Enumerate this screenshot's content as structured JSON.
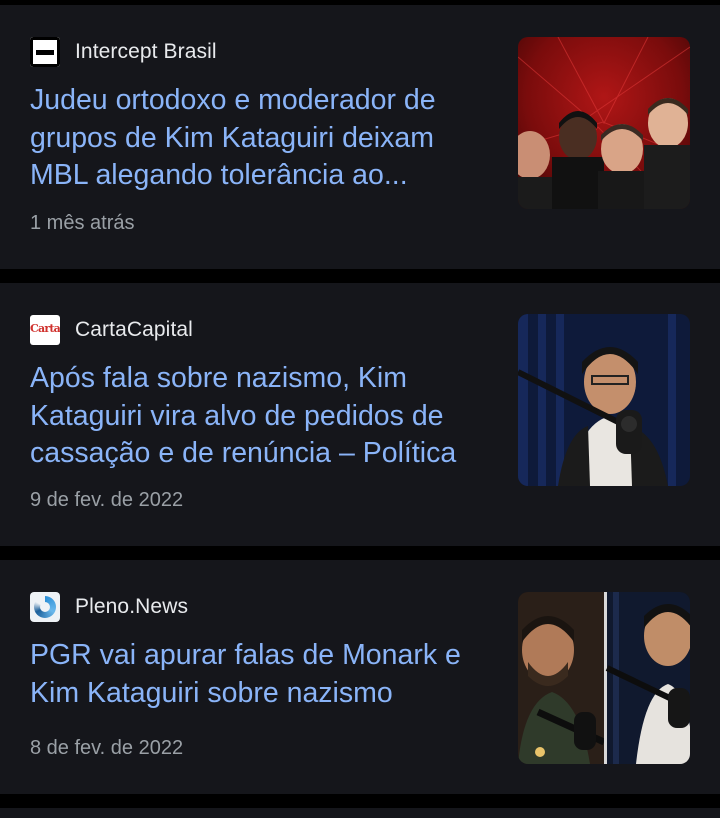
{
  "feed": {
    "articles": [
      {
        "source": "Intercept Brasil",
        "favicon_icon": "intercept-brasil-logo-icon",
        "headline": "Judeu ortodoxo e moderador de grupos de Kim Kataguiri deixam MBL alegando tolerância ao...",
        "timestamp": "1 mês atrás",
        "thumbnail": "four-men-red-background-image"
      },
      {
        "source": "CartaCapital",
        "favicon_icon": "cartacapital-logo-icon",
        "favicon_text": "Carta",
        "headline": "Após fala sobre nazismo, Kim Kataguiri vira alvo de pedidos de cassação e de renúncia – Política",
        "timestamp": "9 de fev. de 2022",
        "thumbnail": "man-at-podcast-microphone-image"
      },
      {
        "source": "Pleno.News",
        "favicon_icon": "pleno-news-logo-icon",
        "headline": "PGR vai apurar falas de Monark e Kim Kataguiri sobre nazismo",
        "timestamp": "8 de fev. de 2022",
        "thumbnail": "two-men-podcast-split-image"
      }
    ]
  },
  "colors": {
    "page_background": "#000000",
    "card_background": "#15161b",
    "headline_link": "#8ab4f8",
    "source_text": "#e8eaed",
    "timestamp_text": "#9aa0a6"
  }
}
